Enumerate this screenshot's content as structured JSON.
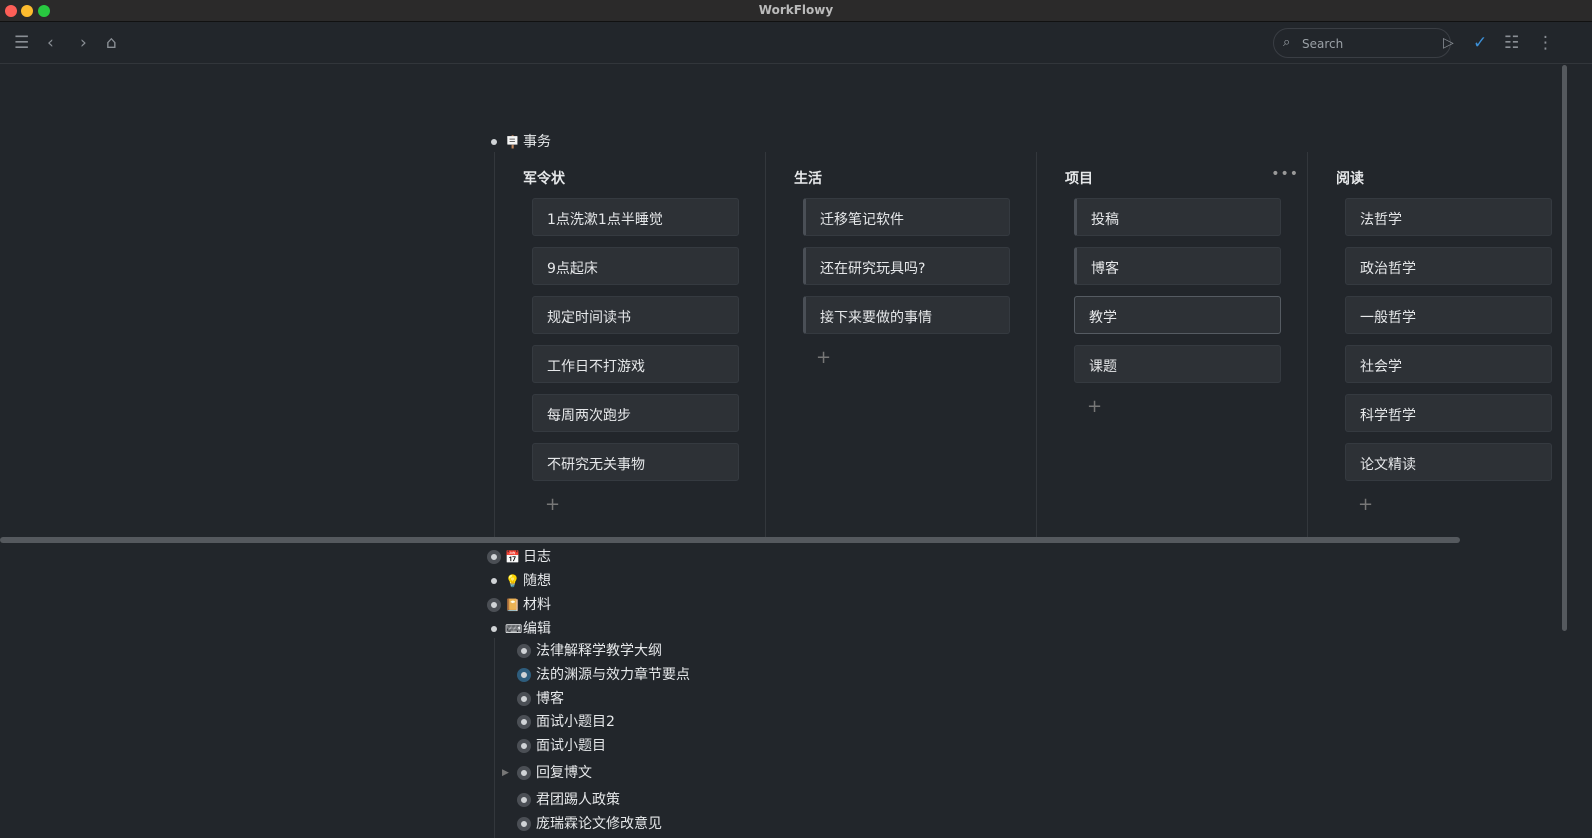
{
  "window": {
    "title": "WorkFlowy"
  },
  "toolbar": {
    "search_placeholder": "Search"
  },
  "board": {
    "title": "事务",
    "icon": "🪧",
    "columns": [
      {
        "title": "军令状",
        "items": [
          "1点洗漱1点半睡觉",
          "9点起床",
          "规定时间读书",
          "工作日不打游戏",
          "每周两次跑步",
          "不研究无关事物"
        ],
        "parents": []
      },
      {
        "title": "生活",
        "items": [
          "迁移笔记软件",
          "还在研究玩具吗?",
          "接下来要做的事情"
        ],
        "parents": [
          0,
          1,
          2
        ]
      },
      {
        "title": "项目",
        "items": [
          "投稿",
          "博客",
          "教学",
          "课题"
        ],
        "parents": [
          0,
          1
        ]
      },
      {
        "title": "阅读",
        "items": [
          "法哲学",
          "政治哲学",
          "一般哲学",
          "社会学",
          "科学哲学",
          "论文精读"
        ],
        "parents": []
      }
    ]
  },
  "add_symbol": "+",
  "tree": [
    {
      "label": "日志",
      "icon": "📅",
      "collapsed": true
    },
    {
      "label": "随想",
      "icon": "💡",
      "collapsed": false
    },
    {
      "label": "材料",
      "icon": "📔",
      "collapsed": true
    },
    {
      "label": "编辑",
      "icon": "⌨",
      "collapsed": false
    }
  ],
  "children": [
    "法律解释学教学大纲",
    "法的渊源与效力章节要点",
    "博客",
    "面试小题目2",
    "面试小题目",
    "回复博文",
    "君团踢人政策",
    "庞瑞霖论文修改意见"
  ]
}
